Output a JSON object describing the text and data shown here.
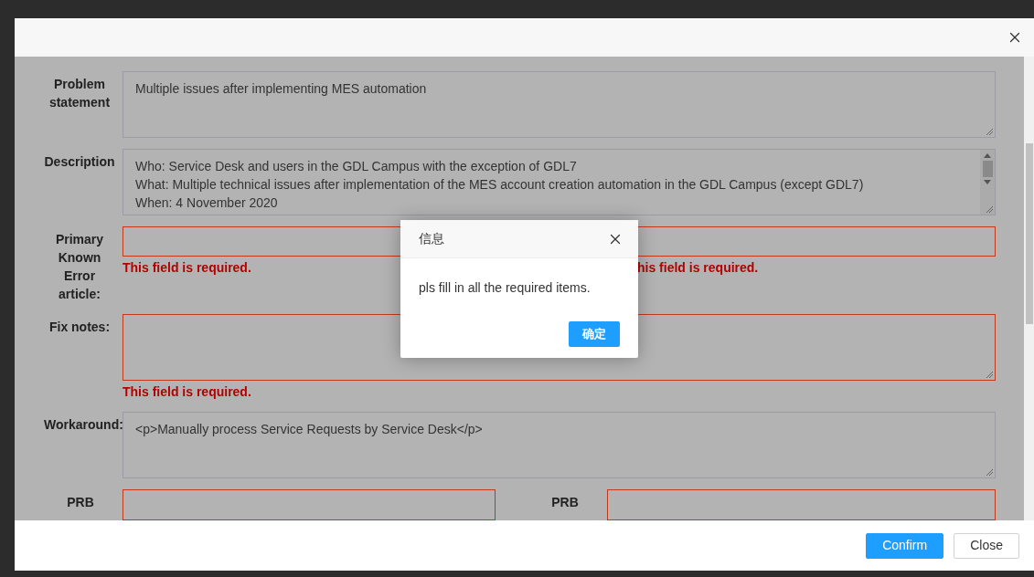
{
  "modal": {
    "footer_buttons": [
      {
        "label": "Confirm",
        "kind": "primary"
      },
      {
        "label": "Close",
        "kind": "default"
      }
    ]
  },
  "form": {
    "rows": [
      {
        "kind": "textarea",
        "label": "Problem statement",
        "lines": [
          "Multiple issues after implementing MES automation"
        ],
        "invalid": false
      },
      {
        "kind": "textarea",
        "label": "Description",
        "lines": [
          "Who: Service Desk and users in the GDL Campus with the exception of GDL7",
          "What: Multiple technical issues after implementation of the MES account creation automation in the GDL Campus (except GDL7)",
          "When: 4 November 2020"
        ],
        "invalid": false,
        "scrollable": true
      },
      {
        "kind": "input",
        "label": "Primary Known Error article:",
        "invalid": true,
        "errors": [
          "This field is required.",
          "his field is required."
        ]
      },
      {
        "kind": "textarea",
        "label": "Fix notes:",
        "invalid": true,
        "errors": [
          "This field is required."
        ]
      },
      {
        "kind": "textarea",
        "label": "Workaround:",
        "lines": [
          "<p>Manually process Service Requests by Service Desk</p>"
        ],
        "invalid": false
      },
      {
        "kind": "pair",
        "fields": [
          {
            "label": "PRB",
            "invalid": true
          },
          {
            "label": "PRB",
            "invalid": true
          }
        ]
      }
    ]
  },
  "dialog": {
    "title": "信息",
    "message": "pls fill in all the required items.",
    "button": "确定"
  }
}
